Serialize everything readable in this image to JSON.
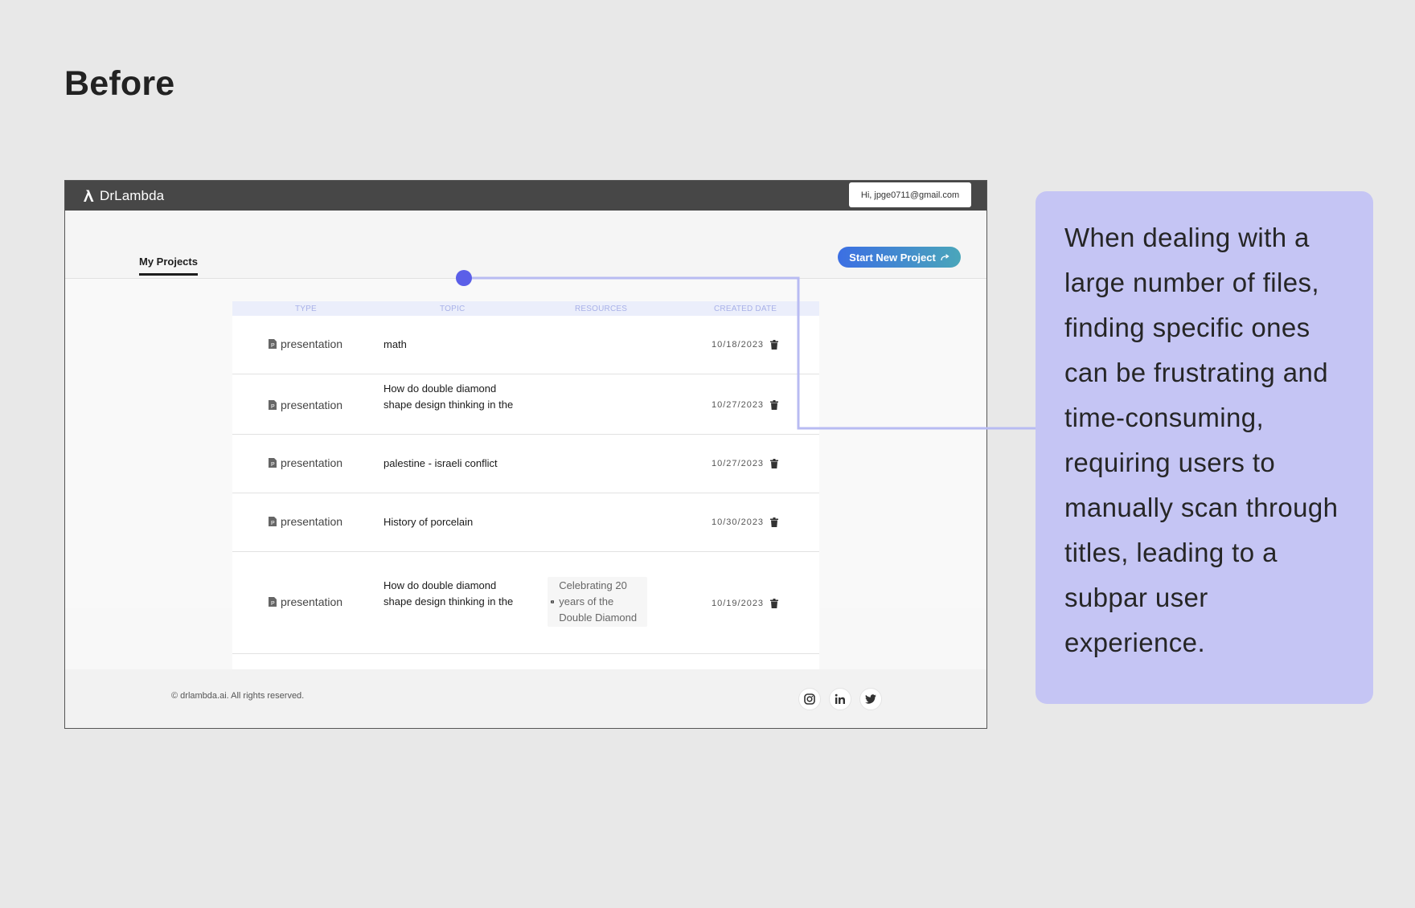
{
  "heading": "Before",
  "app": {
    "brand": "DrLambda",
    "user_greeting": "Hi, jpge0711@gmail.com",
    "tab_label": "My Projects",
    "start_button": "Start New Project"
  },
  "table": {
    "headers": {
      "type": "TYPE",
      "topic": "TOPIC",
      "resources": "RESOURCES",
      "created": "CREATED DATE"
    },
    "rows": [
      {
        "type": "presentation",
        "topic": "math",
        "date": "10/18/2023"
      },
      {
        "type": "presentation",
        "topic": "How do double diamond shape design thinking in the",
        "date": "10/27/2023"
      },
      {
        "type": "presentation",
        "topic": "palestine - israeli conflict",
        "date": "10/27/2023"
      },
      {
        "type": "presentation",
        "topic": "History of porcelain",
        "date": "10/30/2023"
      },
      {
        "type": "presentation",
        "topic": "How do double diamond shape design thinking in the",
        "resource": "Celebrating 20 years of the Double Diamond",
        "date": "10/19/2023"
      }
    ]
  },
  "footer": {
    "copyright": "© drlambda.ai. All rights reserved.",
    "social": [
      "instagram-icon",
      "linkedin-icon",
      "twitter-icon"
    ]
  },
  "callout": {
    "text": "When dealing with a large number of files, finding specific ones can be frustrating and time-consuming, requiring users to manually scan through titles, leading to a subpar user experience."
  },
  "colors": {
    "accent": "#5b5fe8",
    "callout_bg": "#c5c5f4",
    "connector": "#b8bbf2",
    "topbar": "#474747",
    "button_start": "#3c6fe3",
    "button_end": "#4aa6ba"
  }
}
